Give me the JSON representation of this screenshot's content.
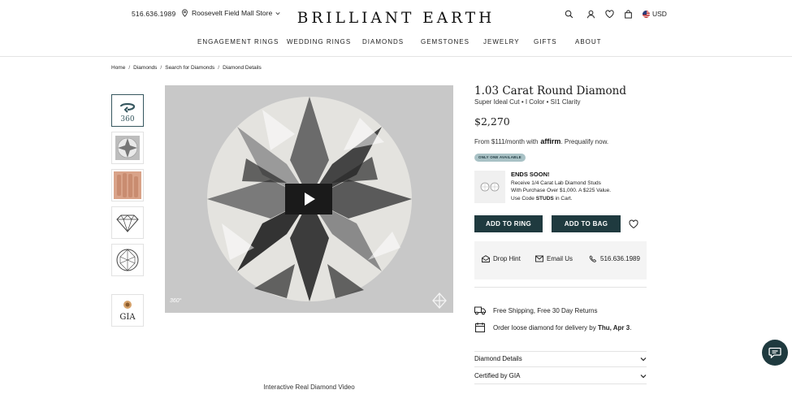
{
  "header": {
    "phone": "516.636.1989",
    "store": "Roosevelt Field Mall Store",
    "logo": "BRILLIANT EARTH",
    "currency": "USD"
  },
  "nav": [
    "ENGAGEMENT RINGS",
    "WEDDING RINGS",
    "DIAMONDS",
    "GEMSTONES",
    "JEWELRY",
    "GIFTS",
    "ABOUT"
  ],
  "breadcrumb": [
    "Home",
    "Diamonds",
    "Search for Diamonds",
    "Diamond Details"
  ],
  "media": {
    "badge": "360°",
    "thumb_360_label": "360",
    "gia_label": "GIA",
    "caption": "Interactive Real Diamond Video"
  },
  "product": {
    "title": "1.03 Carat Round Diamond",
    "subtitle": "Super Ideal Cut • I Color • SI1 Clarity",
    "price": "$2,270",
    "finance_prefix": "From $111/month with",
    "finance_brand": "affirm",
    "finance_suffix": ". Prequalify now.",
    "availability": "ONLY ONE AVAILABLE"
  },
  "promo": {
    "title": "ENDS SOON!",
    "line1": "Receive 1/4 Carat Lab Diamond Studs",
    "line2": "With Purchase Over $1,000. A $225 Value.",
    "line3_pre": "Use Code ",
    "line3_code": "STUDS",
    "line3_post": " in Cart."
  },
  "actions": {
    "add_to_ring": "ADD TO RING",
    "add_to_bag": "ADD TO BAG"
  },
  "contact": {
    "hint": "Drop Hint",
    "email": "Email Us",
    "phone": "516.636.1989"
  },
  "shipping": {
    "line": "Free Shipping, Free 30 Day Returns",
    "delivery_pre": "Order loose diamond for delivery by ",
    "delivery_date": "Thu, Apr 3",
    "delivery_post": "."
  },
  "accordions": [
    "Diamond Details",
    "Certified by GIA"
  ],
  "colors": {
    "accent": "#1f3a3f",
    "pill": "#a9c2c6"
  }
}
